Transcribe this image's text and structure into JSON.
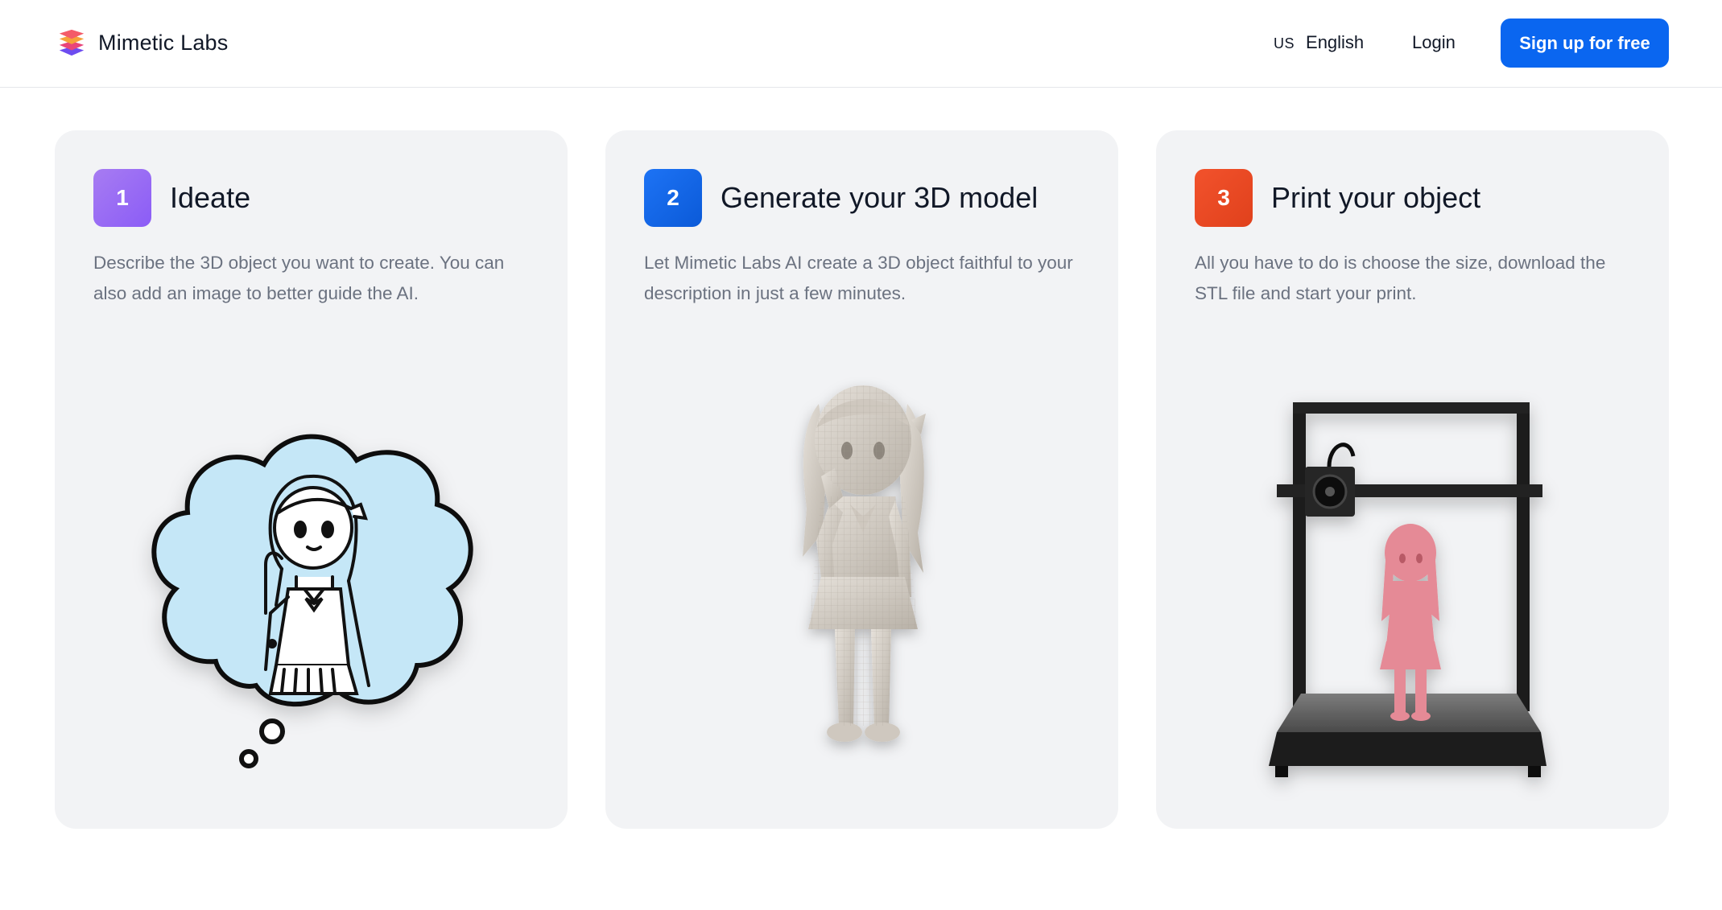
{
  "header": {
    "brand_name": "Mimetic Labs",
    "brand_icon": "layers-logo-icon",
    "language": {
      "code": "US",
      "label": "English"
    },
    "login_label": "Login",
    "signup_label": "Sign up for free"
  },
  "colors": {
    "primary": "#0a66f0",
    "step1": "#8b5cf6",
    "step2": "#0b5ad8",
    "step3": "#e0411c",
    "card_bg": "#f2f3f5",
    "muted_text": "#6b7280"
  },
  "steps": [
    {
      "number": "1",
      "title": "Ideate",
      "description": "Describe the 3D object you want to create. You can also add an image to better guide the AI.",
      "image": "thought-bubble-sketch-icon"
    },
    {
      "number": "2",
      "title": "Generate your 3D model",
      "description": "Let Mimetic Labs AI create a 3D object faithful to your description in just a few minutes.",
      "image": "3d-model-figure-icon"
    },
    {
      "number": "3",
      "title": "Print your object",
      "description": "All you have to do is choose the size, download the STL file and start your print.",
      "image": "3d-printer-icon"
    }
  ]
}
